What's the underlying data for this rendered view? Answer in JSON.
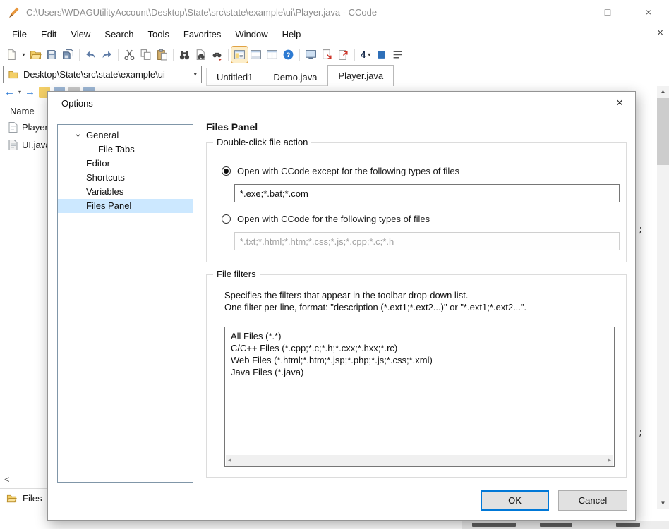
{
  "glyphs": {
    "minimize": "—",
    "maximize": "□",
    "close": "×",
    "caret_down": "▾",
    "back_arrow": "←",
    "forward_arrow": "→",
    "scroll_up": "▲",
    "scroll_down": "▼",
    "scroll_left": "◂",
    "scroll_right": "▸",
    "panel_scroll_left": "<"
  },
  "window": {
    "title": "C:\\Users\\WDAGUtilityAccount\\Desktop\\State\\src\\state\\example\\ui\\Player.java - CCode"
  },
  "menu": {
    "items": [
      "File",
      "Edit",
      "View",
      "Search",
      "Tools",
      "Favorites",
      "Window",
      "Help"
    ]
  },
  "toolbar": {
    "font_size_value": "4",
    "icons": [
      "new-file",
      "new-file-dropdown",
      "open-folder",
      "save",
      "save-all",
      "undo",
      "redo",
      "cut",
      "copy",
      "paste",
      "find",
      "find-in-files",
      "find-next",
      "files-panel-toggle",
      "output-panel",
      "split-window",
      "help",
      "fullscreen",
      "view-in-browser",
      "external-view",
      "font-size-dropdown",
      "block-select",
      "line-list"
    ]
  },
  "pathbar": {
    "path": "Desktop\\State\\src\\state\\example\\ui"
  },
  "tabs": {
    "items": [
      {
        "label": "Untitled1",
        "active": false
      },
      {
        "label": "Demo.java",
        "active": false
      },
      {
        "label": "Player.java",
        "active": true
      }
    ]
  },
  "files_panel": {
    "header": "Name",
    "items": [
      {
        "name": "Player.java"
      },
      {
        "name": "UI.java"
      }
    ],
    "bottom_tab_label": "Files"
  },
  "editor": {
    "visible_fragments": [
      ";",
      ";"
    ]
  },
  "dialog": {
    "title": "Options",
    "tree": {
      "items": [
        {
          "label": "General",
          "expanded": true
        },
        {
          "label": "File Tabs",
          "indent": 1
        },
        {
          "label": "Editor"
        },
        {
          "label": "Shortcuts"
        },
        {
          "label": "Variables"
        },
        {
          "label": "Files Panel",
          "selected": true
        }
      ]
    },
    "heading": "Files Panel",
    "double_click_group": {
      "legend": "Double-click file action",
      "radio_except": {
        "label": "Open with CCode except for the following types of files",
        "checked": true
      },
      "input_except": "*.exe;*.bat;*.com",
      "radio_for": {
        "label": "Open with CCode for the following types of files",
        "checked": false
      },
      "input_for": "*.txt;*.html;*.htm;*.css;*.js;*.cpp;*.c;*.h"
    },
    "file_filters_group": {
      "legend": "File filters",
      "description_line1": "Specifies the filters that appear in the toolbar drop-down list.",
      "description_line2": "One filter per line, format: \"description (*.ext1;*.ext2...)\" or \"*.ext1;*.ext2...\".",
      "filters": [
        "All Files (*.*)",
        "C/C++ Files (*.cpp;*.c;*.h;*.cxx;*.hxx;*.rc)",
        "Web Files (*.html;*.htm;*.jsp;*.php;*.js;*.css;*.xml)",
        "Java Files (*.java)"
      ]
    },
    "buttons": {
      "ok": "OK",
      "cancel": "Cancel"
    }
  }
}
